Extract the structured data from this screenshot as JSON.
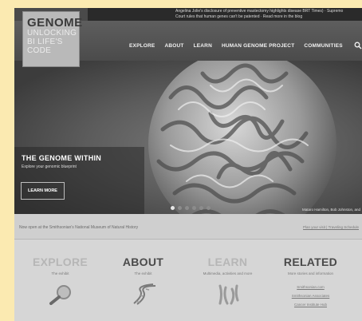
{
  "ticker": {
    "line1": "Angelina Jolie's disclosure of preventive mastectomy highlights disease BRT Times) · Supremo",
    "line2": "Court rules that human genes can't be patented · Read more in the blog"
  },
  "logo": {
    "line1": "GENOME",
    "line2": "UNLOCKING",
    "line3": "BI LIFE'S",
    "line4": "CODE"
  },
  "nav": {
    "items": [
      "EXPLORE",
      "ABOUT",
      "LEARN",
      "HUMAN GENOME PROJECT",
      "COMMUNITIES"
    ],
    "search_icon": "search-icon"
  },
  "hero": {
    "title": "THE GENOME WITHIN",
    "subtitle": "Explore your genomic blueprint",
    "button": "LEARN MORE",
    "credit": "Mataro Hamilton, Bob Johnston, and",
    "slides": 6,
    "active_slide": 0
  },
  "strip": {
    "now_open": "Now open at the Smithsonian's National Museum of Natural History",
    "plan_links": "Plan your visit | Traveling Schedule"
  },
  "cards": [
    {
      "title": "EXPLORE",
      "subtitle": "The exhibit",
      "icon": "magnifier-dna-icon"
    },
    {
      "title": "ABOUT",
      "subtitle": "The exhibit",
      "icon": "dna-helix-icon"
    },
    {
      "title": "LEARN",
      "subtitle": "Multimedia, activities and more",
      "icon": "chromosomes-icon"
    },
    {
      "title": "RELATED",
      "subtitle": "More stories and information",
      "icon": "",
      "links": [
        "Smithsonian.com",
        "Smithsonian Associates",
        "Cancer Institute Hub"
      ]
    }
  ],
  "colors": {
    "page_bg": "#fbeab1",
    "dark_bar": "#4b4b4b",
    "card_bg": "#d6d6d6"
  }
}
